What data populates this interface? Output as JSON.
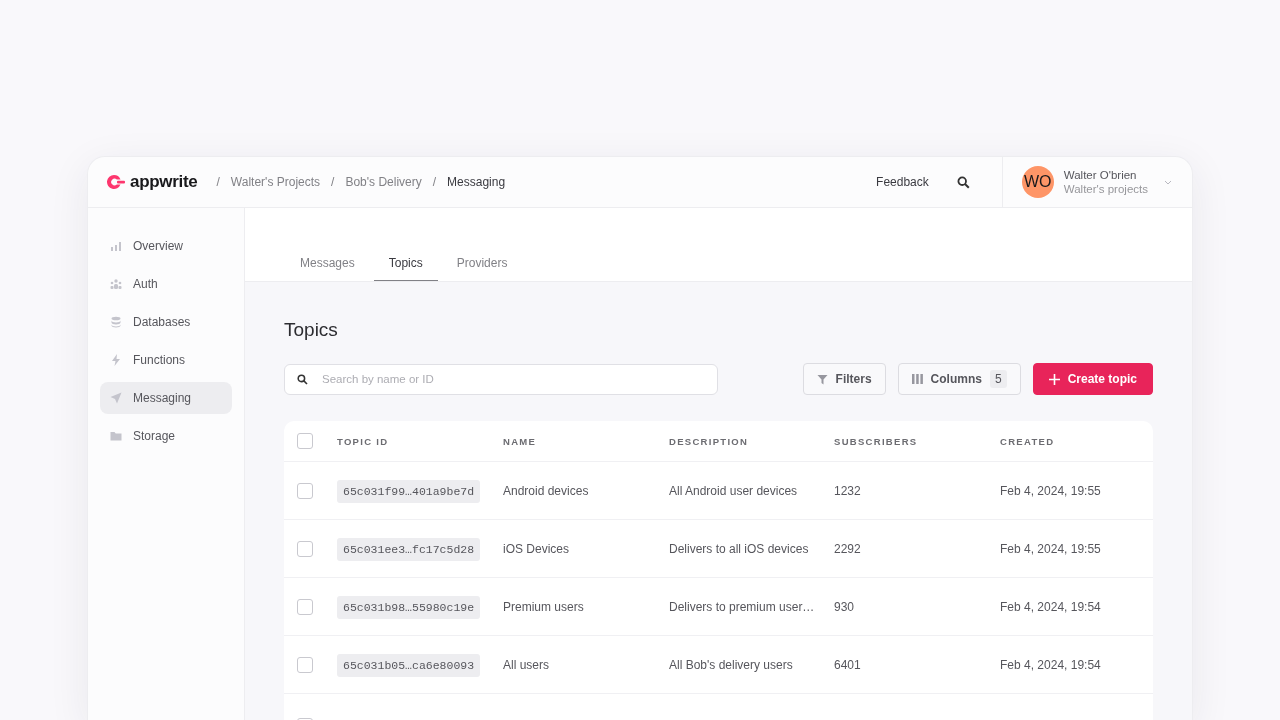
{
  "header": {
    "logo": "appwrite",
    "breadcrumbs": [
      {
        "label": "Walter's Projects",
        "current": false
      },
      {
        "label": "Bob's Delivery",
        "current": false
      },
      {
        "label": "Messaging",
        "current": true
      }
    ],
    "separator": "/",
    "feedback": "Feedback",
    "user": {
      "initials": "WO",
      "name": "Walter O'brien",
      "org": "Walter's projects"
    }
  },
  "sidebar": {
    "items": [
      {
        "label": "Overview",
        "selected": false
      },
      {
        "label": "Auth",
        "selected": false
      },
      {
        "label": "Databases",
        "selected": false
      },
      {
        "label": "Functions",
        "selected": false
      },
      {
        "label": "Messaging",
        "selected": true
      },
      {
        "label": "Storage",
        "selected": false
      }
    ]
  },
  "tabs": [
    {
      "label": "Messages",
      "selected": false
    },
    {
      "label": "Topics",
      "selected": true
    },
    {
      "label": "Providers",
      "selected": false
    }
  ],
  "title": "Topics",
  "search": {
    "placeholder": "Search by name or ID"
  },
  "filters": "Filters",
  "columns_button": {
    "label": "Columns",
    "count": "5"
  },
  "create": "Create topic",
  "table": {
    "columns": [
      "TOPIC ID",
      "NAME",
      "DESCRIPTION",
      "SUBSCRIBERS",
      "CREATED"
    ],
    "all_checked": false,
    "rows": [
      {
        "checked": false,
        "id": "65c031f99…401a9be7d",
        "name": "Android devices",
        "description": "All Android user devices",
        "subscribers": "1232",
        "created": "Feb 4, 2024, 19:55"
      },
      {
        "checked": false,
        "id": "65c031ee3…fc17c5d28",
        "name": "iOS Devices",
        "description": "Delivers to all iOS devices",
        "subscribers": "2292",
        "created": "Feb 4, 2024, 19:55"
      },
      {
        "checked": false,
        "id": "65c031b98…55980c19e",
        "name": "Premium users",
        "description": "Delivers to premium user…",
        "subscribers": "930",
        "created": "Feb 4, 2024, 19:54"
      },
      {
        "checked": false,
        "id": "65c031b05…ca6e80093",
        "name": "All users",
        "description": "All Bob's delivery users",
        "subscribers": "6401",
        "created": "Feb 4, 2024, 19:54"
      }
    ]
  }
}
